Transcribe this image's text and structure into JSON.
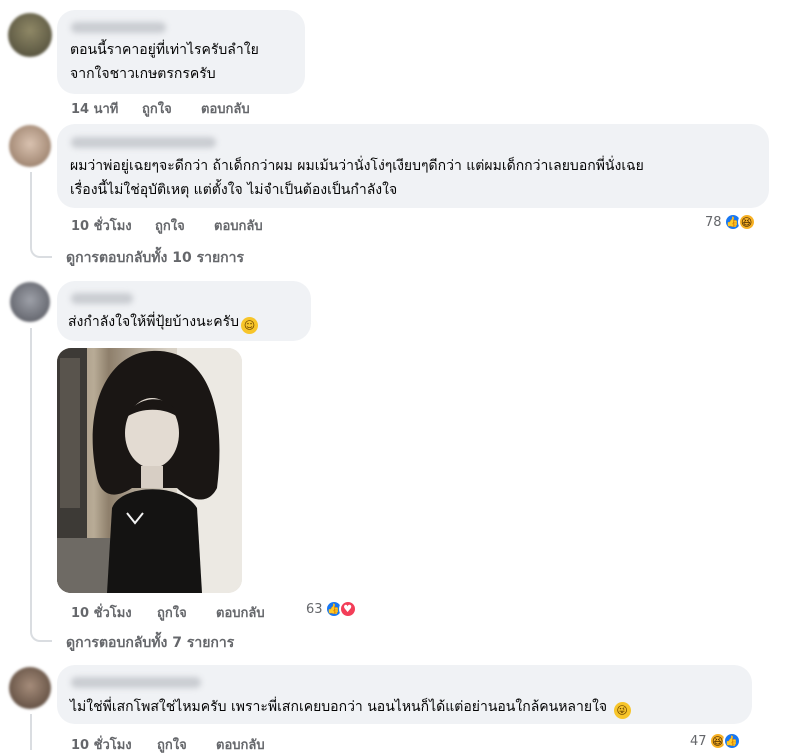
{
  "comments": [
    {
      "lines": [
        "ตอนนี้ราคาอยู่ที่เท่าไรครับลำใย",
        "จากใจชาวเกษตรกรครับ"
      ],
      "time": "14 นาที",
      "like_label": "ถูกใจ",
      "reply_label": "ตอบกลับ"
    },
    {
      "lines": [
        "ผมว่าพ่อยู่เฉยๆจะดีกว่า ถ้าเด็กกว่าผม ผมเม้นว่านั่งโง่ๆเงียบๆดีกว่า แต่ผมเด็กกว่าเลยบอกพี่นั่งเฉย",
        "เรื่องนี้ไม่ใช่อุบัติเหตุ แต่ตั้งใจ ไม่จำเป็นต้องเป็นกำลังใจ"
      ],
      "time": "10 ชั่วโมง",
      "like_label": "ถูกใจ",
      "reply_label": "ตอบกลับ",
      "reaction_count": "78",
      "replies_link": "ดูการตอบกลับทั้ง 10 รายการ"
    },
    {
      "lines": [
        "ส่งกำลังใจให้พี่ปุ้ยบ้างนะครับ"
      ],
      "time": "10 ชั่วโมง",
      "like_label": "ถูกใจ",
      "reply_label": "ตอบกลับ",
      "reaction_count": "63",
      "replies_link": "ดูการตอบกลับทั้ง 7 รายการ"
    },
    {
      "lines": [
        "ไม่ใช่พี่เสกโพสใช่ไหมครับ เพราะพี่เสกเคยบอกว่า นอนไหนก็ได้แต่อย่านอนใกล้คนหลายใจ"
      ],
      "time": "10 ชั่วโมง",
      "like_label": "ถูกใจ",
      "reply_label": "ตอบกลับ",
      "reaction_count": "47"
    }
  ],
  "icons": {
    "like": "like-icon",
    "haha": "haha-icon",
    "love": "love-icon",
    "emoji": "smiling-face-icon"
  },
  "colors": {
    "bubble": "#f0f2f5",
    "meta_text": "#65676b",
    "like_blue": "#1877f2",
    "love_red": "#f33e58",
    "haha_yellow": "#f7b125"
  }
}
